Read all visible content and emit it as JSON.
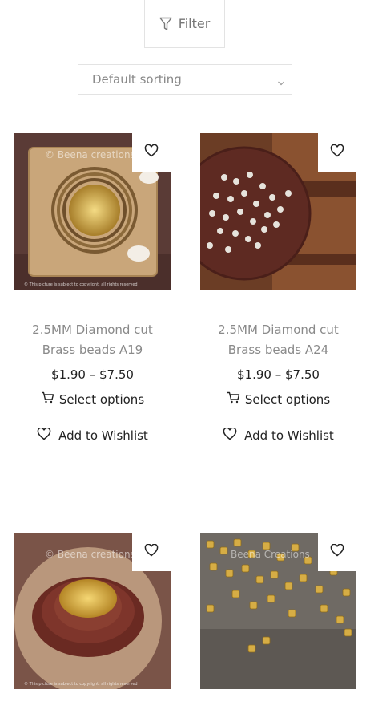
{
  "filter": {
    "label": "Filter",
    "icon": "filter-icon"
  },
  "sorting": {
    "selected": "Default sorting",
    "icon": "chevron-down-icon"
  },
  "products": [
    {
      "title": "2.5MM Diamond cut Brass beads A19",
      "price": "$1.90 – $7.50",
      "select_label": "Select options",
      "wishlist_label": "Add to Wishlist",
      "watermark": "© Beena creations",
      "copyright": "© This picture is subject to copyright, all rights reserved"
    },
    {
      "title": "2.5MM Diamond cut Brass beads A24",
      "price": "$1.90 – $7.50",
      "select_label": "Select options",
      "wishlist_label": "Add to Wishlist",
      "watermark": "",
      "copyright": ""
    },
    {
      "title": "",
      "price": "",
      "select_label": "",
      "wishlist_label": "",
      "watermark": "© Beena creations",
      "copyright": "© This picture is subject to copyright, all rights reserved"
    },
    {
      "title": "",
      "price": "",
      "select_label": "",
      "wishlist_label": "",
      "watermark": "Beena Creations",
      "copyright": ""
    }
  ],
  "colors": {
    "border": "#e3e3e3",
    "muted_text": "#8a8a8a",
    "text": "#222222"
  }
}
